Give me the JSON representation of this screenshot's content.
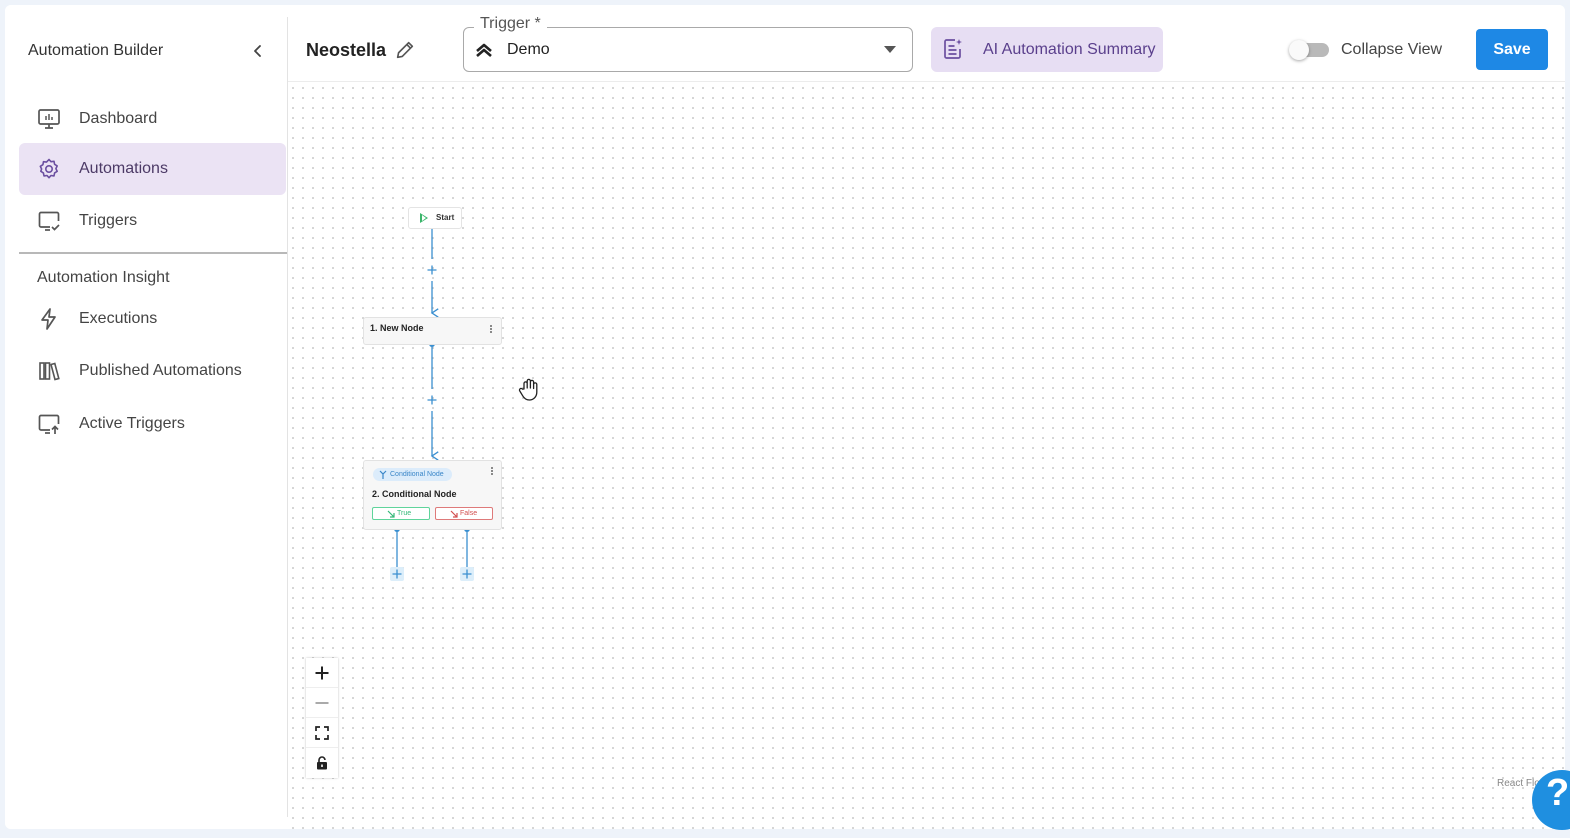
{
  "sidebar": {
    "title": "Automation Builder",
    "items": [
      {
        "label": "Dashboard",
        "icon": "monitor-icon"
      },
      {
        "label": "Automations",
        "icon": "gear-icon",
        "active": true
      },
      {
        "label": "Triggers",
        "icon": "screen-check-icon"
      }
    ],
    "section_title": "Automation Insight",
    "insight_items": [
      {
        "label": "Executions",
        "icon": "lightning-icon"
      },
      {
        "label": "Published Automations",
        "icon": "library-icon"
      },
      {
        "label": "Active Triggers",
        "icon": "screen-upload-icon"
      }
    ]
  },
  "header": {
    "project_name": "Neostella",
    "trigger_label": "Trigger *",
    "trigger_value": "Demo",
    "ai_summary_label": "AI Automation Summary",
    "collapse_view_label": "Collapse View",
    "collapse_view_on": false,
    "save_label": "Save"
  },
  "flow": {
    "start_label": "Start",
    "node1_label": "1. New Node",
    "node2_tag": "Conditional Node",
    "node2_label": "2. Conditional Node",
    "true_label": "True",
    "false_label": "False",
    "add_symbol": "+"
  },
  "canvas": {
    "attribution": "React Flow"
  },
  "help": {
    "symbol": "?"
  },
  "colors": {
    "accent": "#1e88e5",
    "active_nav_bg": "#ebe3f4",
    "ai_button_bg": "#e7def3",
    "edge": "#3a8fd0",
    "true": "#33b877",
    "false": "#d24f4f"
  }
}
